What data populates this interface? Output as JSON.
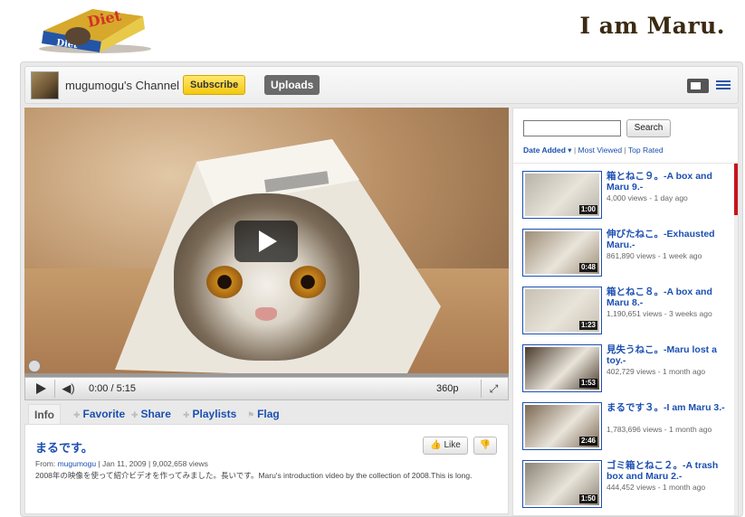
{
  "header": {
    "logo_icon": "diet-box-logo",
    "site_title": "I am Maru."
  },
  "channel": {
    "name": "mugumogu's Channel",
    "subscribe_label": "Subscribe",
    "uploads_label": "Uploads",
    "view_icons": [
      "player-view-icon",
      "list-view-icon"
    ]
  },
  "player": {
    "time": "0:00 / 5:15",
    "quality": "360p",
    "volume_icon": "speaker-icon",
    "fullscreen_glyph": "⤢"
  },
  "tabs": [
    "Info",
    "Favorite",
    "Share",
    "Playlists",
    "Flag"
  ],
  "video": {
    "title": "まるです。",
    "like_label": "Like",
    "from_label": "From:",
    "uploader": "mugumogu",
    "date_views": "| Jan 11, 2009  | 9,002,658 views",
    "description": "2008年の映像を使って紹介ビデオを作ってみました。長いです。Maru's introduction video by the collection of 2008.This is long."
  },
  "sidebar": {
    "search_value": "",
    "search_button": "Search",
    "sorts": [
      {
        "label": "Date Added",
        "active": true
      },
      {
        "label": "Most Viewed",
        "active": false
      },
      {
        "label": "Top Rated",
        "active": false
      }
    ],
    "items": [
      {
        "title": "箱とねこ９。-A box and Maru 9.-",
        "meta": "4,000 views - 1 day ago",
        "duration": "1:00",
        "bg": "#b7b3a9"
      },
      {
        "title": "伸びたねこ。-Exhausted Maru.-",
        "meta": "861,890 views - 1 week ago",
        "duration": "0:48",
        "bg": "#9d8e78"
      },
      {
        "title": "箱とねこ８。-A box and Maru 8.-",
        "meta": "1,190,651 views - 3 weeks ago",
        "duration": "1:23",
        "bg": "#c7c0b2"
      },
      {
        "title": "見失うねこ。-Maru lost a toy.-",
        "meta": "402,729 views - 1 month ago",
        "duration": "1:53",
        "bg": "#4a3b2c"
      },
      {
        "title": "まるです３。-I am Maru 3.-",
        "meta": "1,783,696 views - 1 month ago",
        "duration": "2:46",
        "bg": "#7c6953"
      },
      {
        "title": "ゴミ箱とねこ２。-A trash box and Maru 2.-",
        "meta": "444,452 views - 1 month ago",
        "duration": "1:50",
        "bg": "#8b8478"
      }
    ]
  }
}
